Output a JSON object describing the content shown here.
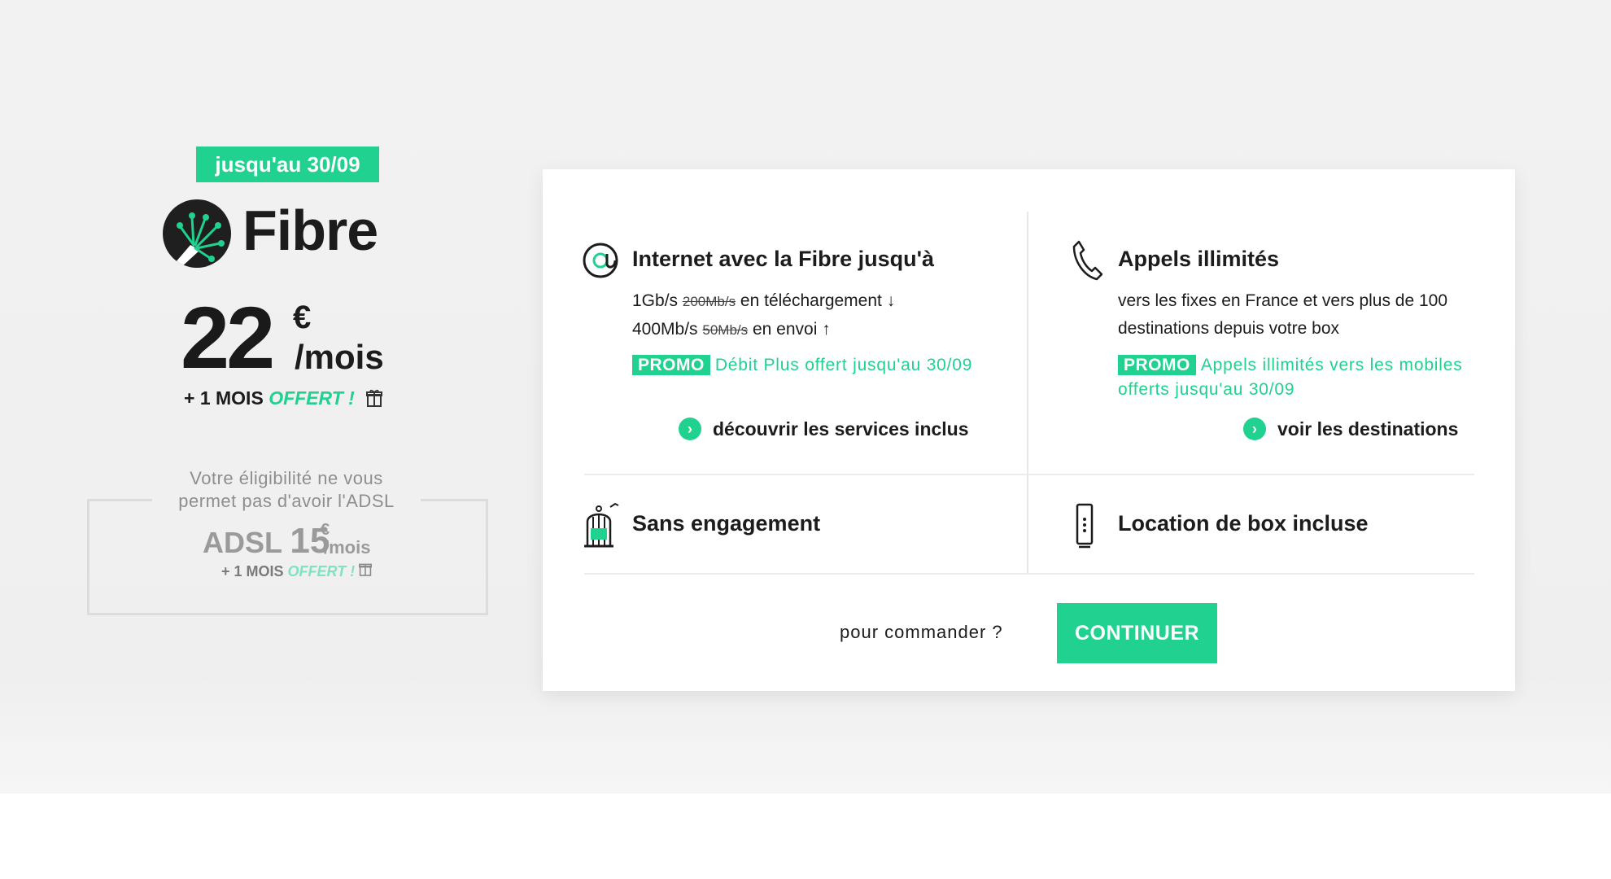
{
  "offer": {
    "promo_tag": "jusqu'au 30/09",
    "title": "Fibre",
    "price": "22",
    "currency": "€",
    "period": "/mois",
    "bonus_prefix": "+ 1 MOIS",
    "bonus_highlight": "OFFERT !",
    "accent_color": "#20d18f"
  },
  "eligibility": {
    "message": "Votre éligibilité ne vous permet pas d'avoir l'ADSL",
    "adsl_label": "ADSL",
    "adsl_price": "15",
    "adsl_currency": "€",
    "adsl_period": "/mois",
    "adsl_bonus_prefix": "+ 1 MOIS",
    "adsl_bonus_highlight": "OFFERT !"
  },
  "features": {
    "internet": {
      "icon": "at-sign-icon",
      "title": "Internet avec la Fibre jusqu'à",
      "line1_speed": "1Gb/s",
      "line1_old": "200Mb/s",
      "line1_rest": "en téléchargement ↓",
      "line2_speed": "400Mb/s",
      "line2_old": "50Mb/s",
      "line2_rest": "en envoi ↑",
      "promo_badge": "PROMO",
      "promo_text": "Débit Plus offert jusqu'au 30/09",
      "link_label": "découvrir les services inclus"
    },
    "calls": {
      "icon": "phone-handset-icon",
      "title": "Appels illimités",
      "body": "vers les fixes en France et vers plus de 100 destinations depuis votre box",
      "promo_badge": "PROMO",
      "promo_text": "Appels illimités vers les mobiles offerts jusqu'au 30/09",
      "link_label": "voir les destinations"
    },
    "no_commitment": {
      "icon": "birdcage-icon",
      "title": "Sans engagement"
    },
    "box_rental": {
      "icon": "router-box-icon",
      "title": "Location de box incluse"
    }
  },
  "order": {
    "prompt": "pour commander ?",
    "button_label": "CONTINUER"
  }
}
